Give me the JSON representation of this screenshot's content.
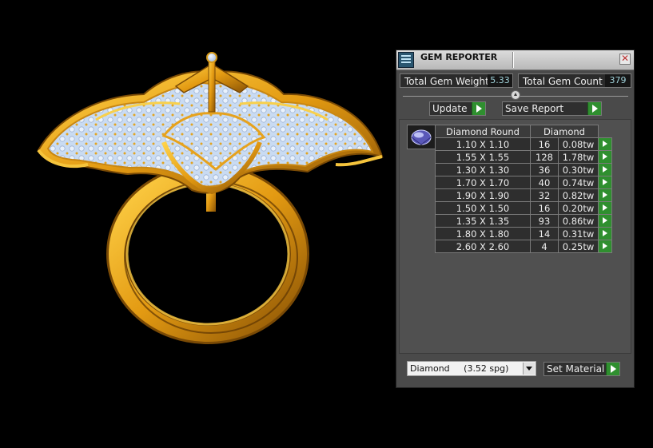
{
  "panel": {
    "title": "GEM REPORTER",
    "close_glyph": "✕",
    "total_weight_label": "Total Gem Weight",
    "total_weight_value": "5.33",
    "total_count_label": "Total Gem Count",
    "total_count_value": "379",
    "update_label": "Update",
    "save_report_label": "Save Report",
    "table": {
      "header_size": "Diamond Round",
      "header_type": "Diamond",
      "rows": [
        {
          "size": "1.10 X 1.10",
          "count": "16",
          "weight": "0.08tw"
        },
        {
          "size": "1.55 X 1.55",
          "count": "128",
          "weight": "1.78tw"
        },
        {
          "size": "1.30 X 1.30",
          "count": "36",
          "weight": "0.30tw"
        },
        {
          "size": "1.70 X 1.70",
          "count": "40",
          "weight": "0.74tw"
        },
        {
          "size": "1.90 X 1.90",
          "count": "32",
          "weight": "0.82tw"
        },
        {
          "size": "1.50 X 1.50",
          "count": "16",
          "weight": "0.20tw"
        },
        {
          "size": "1.35 X 1.35",
          "count": "93",
          "weight": "0.86tw"
        },
        {
          "size": "1.80 X 1.80",
          "count": "14",
          "weight": "0.31tw"
        },
        {
          "size": "2.60 X 2.60",
          "count": "4",
          "weight": "0.25tw"
        }
      ]
    },
    "material_value": "Diamond     (3.52 spg)",
    "set_material_label": "Set Material"
  },
  "colors": {
    "gold": "#e7a21c",
    "stone": "#cfe0f5",
    "panel_bg": "#4a4a4a",
    "go_green": "#2f8f2f"
  }
}
